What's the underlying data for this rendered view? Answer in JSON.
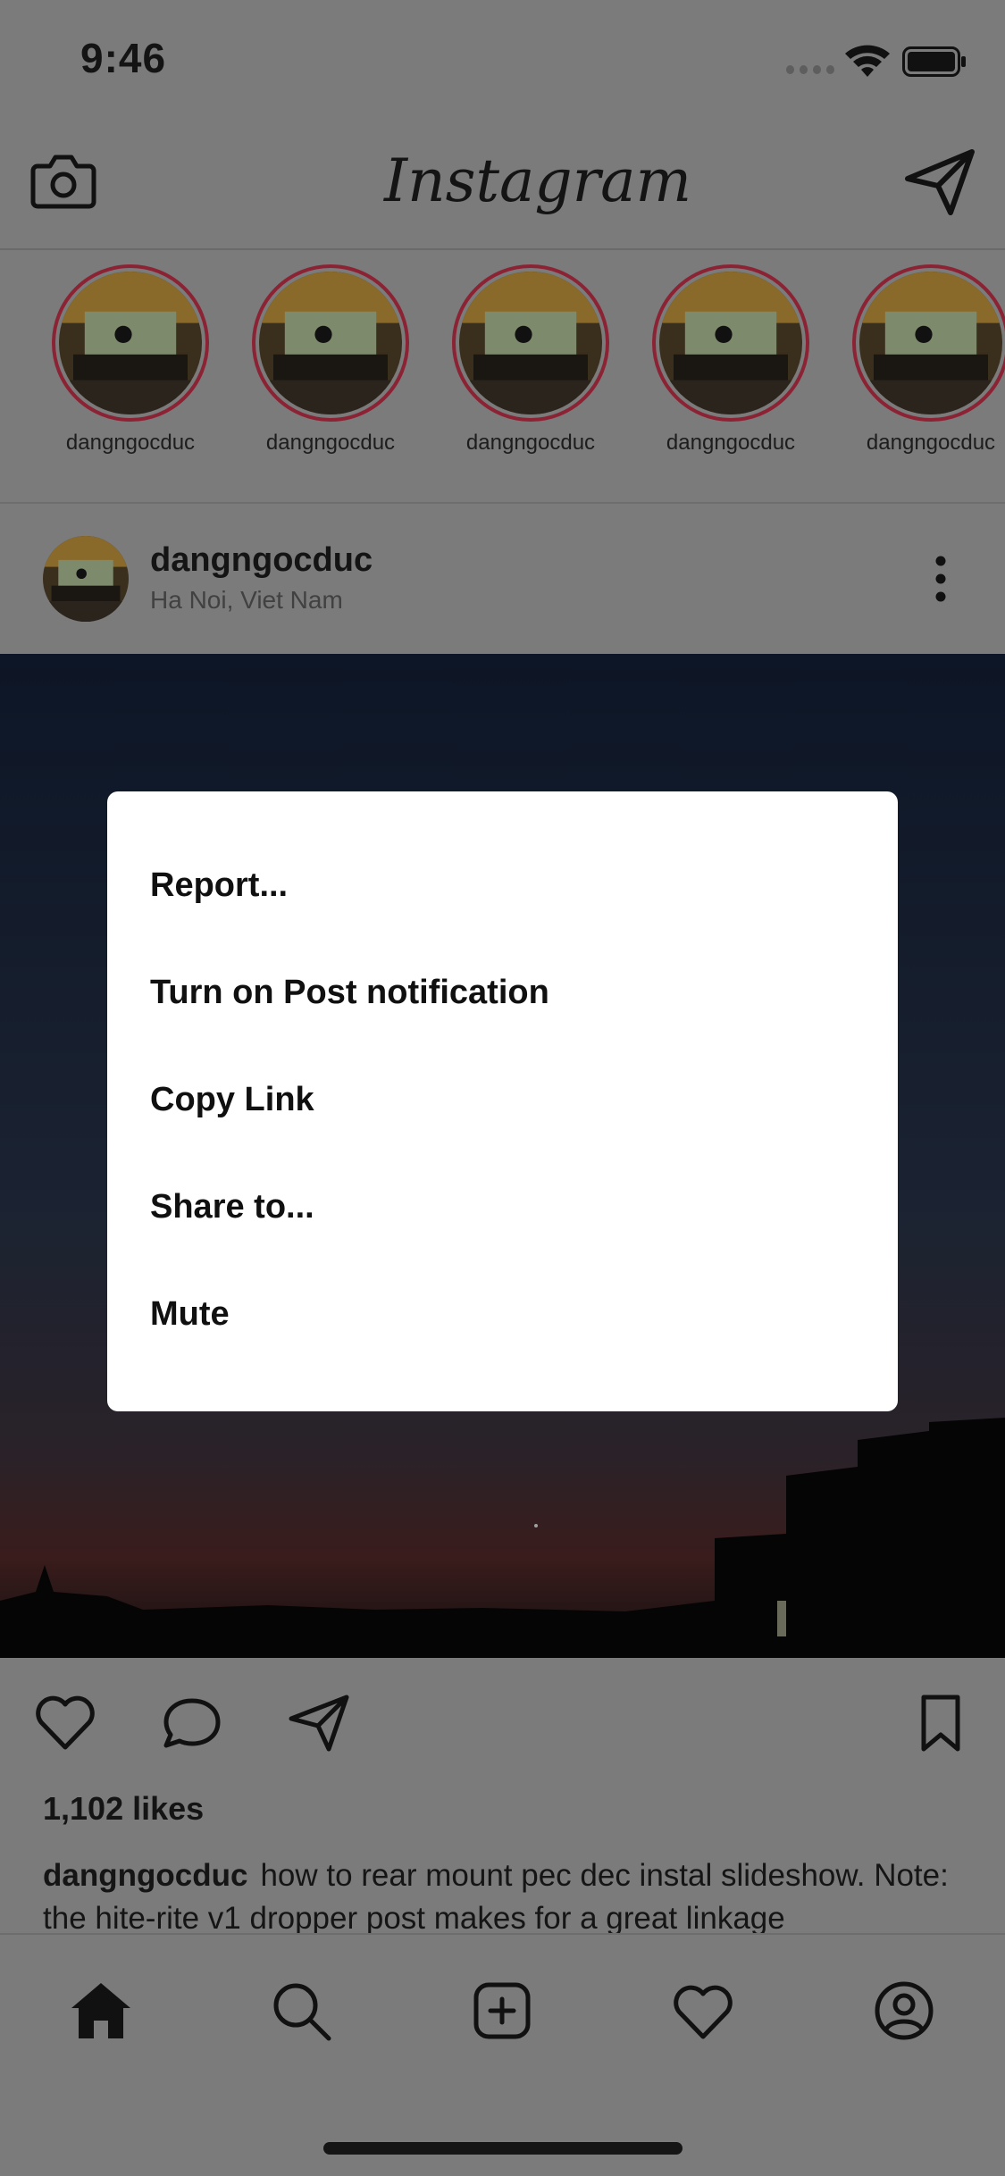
{
  "status_bar": {
    "time": "9:46"
  },
  "header": {
    "logo_text": "Instagram"
  },
  "stories": [
    {
      "username": "dangngocduc"
    },
    {
      "username": "dangngocduc"
    },
    {
      "username": "dangngocduc"
    },
    {
      "username": "dangngocduc"
    },
    {
      "username": "dangngocduc"
    }
  ],
  "post": {
    "author": "dangngocduc",
    "location": "Ha Noi, Viet Nam",
    "likes": "1,102 likes",
    "caption_author": "dangngocduc",
    "caption_text": "how to rear mount pec dec instal slideshow. Note: the hite-rite v1 dropper post makes for a great linkage"
  },
  "menu": {
    "items": [
      {
        "label": "Report..."
      },
      {
        "label": "Turn on Post notification"
      },
      {
        "label": "Copy Link"
      },
      {
        "label": "Share to..."
      },
      {
        "label": "Mute"
      }
    ]
  },
  "tabs": [
    "home-icon",
    "search-icon",
    "add-post-icon",
    "activity-icon",
    "profile-icon"
  ],
  "colors": {
    "dim_background": "#7b7b7b",
    "story_ring": "#8c2334",
    "modal": "#ffffff"
  }
}
